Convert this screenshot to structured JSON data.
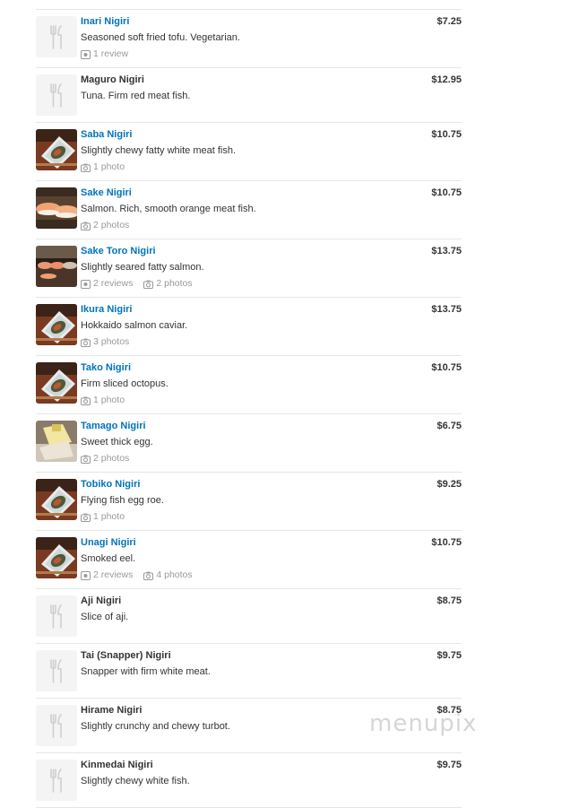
{
  "colors": {
    "link": "#0073bb",
    "text": "#333333",
    "meta": "#999999",
    "divider": "#e6e6e6"
  },
  "items": [
    {
      "name": "Inari Nigiri",
      "linked": true,
      "price": "$7.25",
      "description": "Seasoned soft fried tofu. Vegetarian.",
      "reviews": "1 review",
      "photos": "",
      "image": "placeholder"
    },
    {
      "name": "Maguro Nigiri",
      "linked": false,
      "price": "$12.95",
      "description": "Tuna. Firm red meat fish.",
      "reviews": "",
      "photos": "",
      "image": "placeholder"
    },
    {
      "name": "Saba Nigiri",
      "linked": true,
      "price": "$10.75",
      "description": "Slightly chewy fatty white meat fish.",
      "reviews": "",
      "photos": "1 photo",
      "image": "plate"
    },
    {
      "name": "Sake Nigiri",
      "linked": true,
      "price": "$10.75",
      "description": "Salmon. Rich, smooth orange meat fish.",
      "reviews": "",
      "photos": "2 photos",
      "image": "salmon"
    },
    {
      "name": "Sake Toro Nigiri",
      "linked": true,
      "price": "$13.75",
      "description": "Slightly seared fatty salmon.",
      "reviews": "2 reviews",
      "photos": "2 photos",
      "image": "counter"
    },
    {
      "name": "Ikura Nigiri",
      "linked": true,
      "price": "$13.75",
      "description": "Hokkaido salmon caviar.",
      "reviews": "",
      "photos": "3 photos",
      "image": "plate"
    },
    {
      "name": "Tako Nigiri",
      "linked": true,
      "price": "$10.75",
      "description": "Firm sliced octopus.",
      "reviews": "",
      "photos": "1 photo",
      "image": "plate"
    },
    {
      "name": "Tamago Nigiri",
      "linked": true,
      "price": "$6.75",
      "description": "Sweet thick egg.",
      "reviews": "",
      "photos": "2 photos",
      "image": "egg"
    },
    {
      "name": "Tobiko Nigiri",
      "linked": true,
      "price": "$9.25",
      "description": "Flying fish egg roe.",
      "reviews": "",
      "photos": "1 photo",
      "image": "plate"
    },
    {
      "name": "Unagi Nigiri",
      "linked": true,
      "price": "$10.75",
      "description": "Smoked eel.",
      "reviews": "2 reviews",
      "photos": "4 photos",
      "image": "plate"
    },
    {
      "name": "Aji Nigiri",
      "linked": false,
      "price": "$8.75",
      "description": "Slice of aji.",
      "reviews": "",
      "photos": "",
      "image": "placeholder"
    },
    {
      "name": "Tai (Snapper) Nigiri",
      "linked": false,
      "price": "$9.75",
      "description": "Snapper with firm white meat.",
      "reviews": "",
      "photos": "",
      "image": "placeholder"
    },
    {
      "name": "Hirame Nigiri",
      "linked": false,
      "price": "$8.75",
      "description": "Slightly crunchy and chewy turbot.",
      "reviews": "",
      "photos": "",
      "image": "placeholder"
    },
    {
      "name": "Kinmedai Nigiri",
      "linked": false,
      "price": "$9.75",
      "description": "Slightly chewy white fish.",
      "reviews": "",
      "photos": "",
      "image": "placeholder"
    }
  ],
  "watermark": "menupix"
}
